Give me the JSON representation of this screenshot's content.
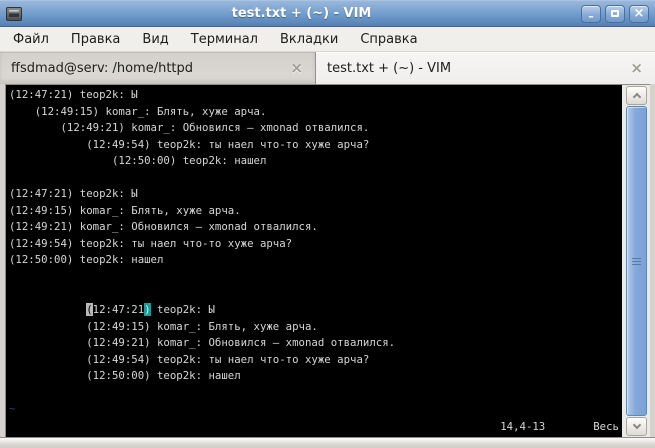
{
  "window": {
    "title": "test.txt + (~) - VIM",
    "controls": {
      "minimize_icon": "–",
      "close_icon": "×"
    }
  },
  "menubar": {
    "items": [
      "Файл",
      "Правка",
      "Вид",
      "Терминал",
      "Вкладки",
      "Справка"
    ]
  },
  "tabs": [
    {
      "label": "ffsdmad@serv: /home/httpd",
      "close_icon": "×",
      "active": false
    },
    {
      "label": "test.txt + (~) - VIM",
      "close_icon": "×",
      "active": true
    }
  ],
  "terminal": {
    "lines": [
      [
        {
          "t": "(12:47:21) teop2k: Ы"
        }
      ],
      [
        {
          "t": "    (12:49:15) komar_: Блять, хуже арча."
        }
      ],
      [
        {
          "t": "        (12:49:21) komar_: Обновился — xmonad отвалился."
        }
      ],
      [
        {
          "t": "            (12:49:54) teop2k: ты наел что-то хуже арча?"
        }
      ],
      [
        {
          "t": "                (12:50:00) teop2k: нашел"
        }
      ],
      [],
      [
        {
          "t": "(12:47:21) teop2k: Ы"
        }
      ],
      [
        {
          "t": "(12:49:15) komar_: Блять, хуже арча."
        }
      ],
      [
        {
          "t": "(12:49:21) komar_: Обновился — xmonad отвалился."
        }
      ],
      [
        {
          "t": "(12:49:54) teop2k: ты наел что-то хуже арча?"
        }
      ],
      [
        {
          "t": "(12:50:00) teop2k: нашел"
        }
      ],
      [],
      [],
      [
        {
          "t": "            "
        },
        {
          "t": "(",
          "s": "cursor"
        },
        {
          "t": "12:47:21"
        },
        {
          "t": ")",
          "s": "match"
        },
        {
          "t": " teop2k: Ы"
        }
      ],
      [
        {
          "t": "            (12:49:15) komar_: Блять, хуже арча."
        }
      ],
      [
        {
          "t": "            (12:49:21) komar_: Обновился — xmonad отвалился."
        }
      ],
      [
        {
          "t": "            (12:49:54) teop2k: ты наел что-то хуже арча?"
        }
      ],
      [
        {
          "t": "            (12:50:00) teop2k: нашел"
        }
      ],
      [],
      [
        {
          "t": "~",
          "s": "nontext"
        }
      ]
    ],
    "statusline": {
      "ruler": "14,4-13",
      "scroll_position": "Весь"
    }
  }
}
